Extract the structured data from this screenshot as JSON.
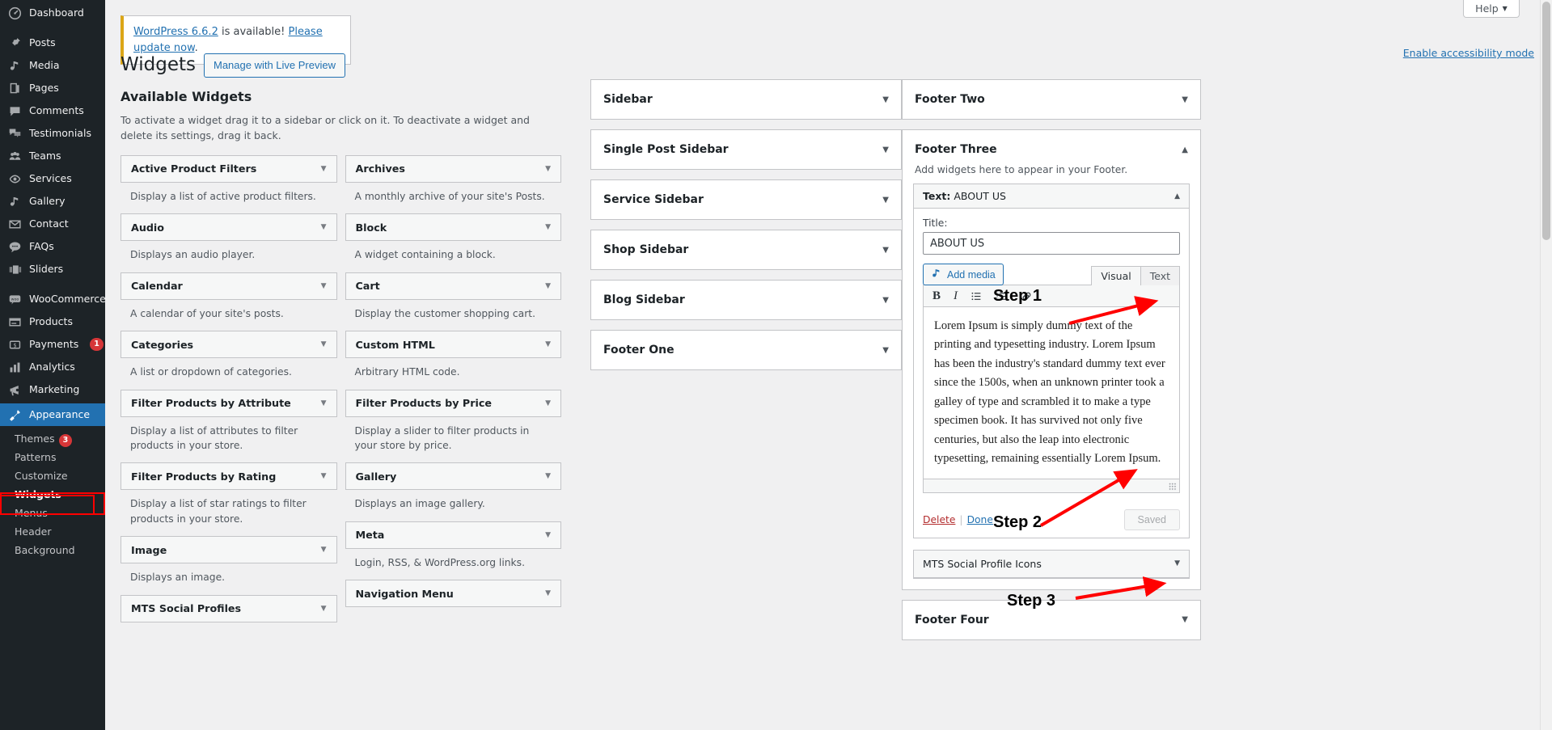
{
  "admin_menu": {
    "items": [
      {
        "label": "Dashboard",
        "icon": "dashboard-icon",
        "badge": null
      },
      {
        "label": "Posts",
        "icon": "pin-icon",
        "badge": null,
        "gap": true
      },
      {
        "label": "Media",
        "icon": "media-icon",
        "badge": null
      },
      {
        "label": "Pages",
        "icon": "pages-icon",
        "badge": null
      },
      {
        "label": "Comments",
        "icon": "comments-icon",
        "badge": null
      },
      {
        "label": "Testimonials",
        "icon": "testimonials-icon",
        "badge": null
      },
      {
        "label": "Teams",
        "icon": "teams-icon",
        "badge": null
      },
      {
        "label": "Services",
        "icon": "services-icon",
        "badge": null
      },
      {
        "label": "Gallery",
        "icon": "gallery-icon",
        "badge": null
      },
      {
        "label": "Contact",
        "icon": "contact-icon",
        "badge": null
      },
      {
        "label": "FAQs",
        "icon": "faqs-icon",
        "badge": null
      },
      {
        "label": "Sliders",
        "icon": "sliders-icon",
        "badge": null
      },
      {
        "label": "WooCommerce",
        "icon": "woocommerce-icon",
        "badge": null,
        "gap": true
      },
      {
        "label": "Products",
        "icon": "products-icon",
        "badge": null
      },
      {
        "label": "Payments",
        "icon": "payments-icon",
        "badge": "1"
      },
      {
        "label": "Analytics",
        "icon": "analytics-icon",
        "badge": null
      },
      {
        "label": "Marketing",
        "icon": "marketing-icon",
        "badge": null
      },
      {
        "label": "Appearance",
        "icon": "appearance-icon",
        "badge": null,
        "current": true
      }
    ],
    "submenu": [
      {
        "label": "Themes",
        "badge": "3"
      },
      {
        "label": "Patterns",
        "badge": null
      },
      {
        "label": "Customize",
        "badge": null
      },
      {
        "label": "Widgets",
        "badge": null,
        "active": true
      },
      {
        "label": "Menus",
        "badge": null
      },
      {
        "label": "Header",
        "badge": null
      },
      {
        "label": "Background",
        "badge": null
      }
    ]
  },
  "notice": {
    "link_version": "WordPress 6.6.2",
    "middle": " is available! ",
    "link_update": "Please update now",
    "period": "."
  },
  "header": {
    "help_label": "Help",
    "accessibility_link": "Enable accessibility mode",
    "page_title": "Widgets",
    "live_preview_label": "Manage with Live Preview"
  },
  "available": {
    "title": "Available Widgets",
    "description": "To activate a widget drag it to a sidebar or click on it. To deactivate a widget and delete its settings, drag it back.",
    "widgets_left": [
      {
        "name": "Active Product Filters",
        "desc": "Display a list of active product filters."
      },
      {
        "name": "Audio",
        "desc": "Displays an audio player."
      },
      {
        "name": "Calendar",
        "desc": "A calendar of your site's posts."
      },
      {
        "name": "Categories",
        "desc": "A list or dropdown of categories."
      },
      {
        "name": "Filter Products by Attribute",
        "desc": "Display a list of attributes to filter products in your store."
      },
      {
        "name": "Filter Products by Rating",
        "desc": "Display a list of star ratings to filter products in your store."
      },
      {
        "name": "Image",
        "desc": "Displays an image."
      },
      {
        "name": "MTS Social Profiles",
        "desc": ""
      }
    ],
    "widgets_right": [
      {
        "name": "Archives",
        "desc": "A monthly archive of your site's Posts."
      },
      {
        "name": "Block",
        "desc": "A widget containing a block."
      },
      {
        "name": "Cart",
        "desc": "Display the customer shopping cart."
      },
      {
        "name": "Custom HTML",
        "desc": "Arbitrary HTML code."
      },
      {
        "name": "Filter Products by Price",
        "desc": "Display a slider to filter products in your store by price."
      },
      {
        "name": "Gallery",
        "desc": "Displays an image gallery."
      },
      {
        "name": "Meta",
        "desc": "Login, RSS, & WordPress.org links."
      },
      {
        "name": "Navigation Menu",
        "desc": ""
      }
    ]
  },
  "sidebars": [
    {
      "name": "Sidebar"
    },
    {
      "name": "Single Post Sidebar"
    },
    {
      "name": "Service Sidebar"
    },
    {
      "name": "Shop Sidebar"
    },
    {
      "name": "Blog Sidebar"
    },
    {
      "name": "Footer One"
    }
  ],
  "footers": {
    "footer_two": {
      "name": "Footer Two"
    },
    "footer_three": {
      "name": "Footer Three",
      "description": "Add widgets here to appear in your Footer.",
      "widget": {
        "header": "Text: ABOUT US",
        "header_prefix": "Text:",
        "header_value": "ABOUT US",
        "title_label": "Title:",
        "title_value": "ABOUT US",
        "add_media_label": "Add media",
        "tab_visual": "Visual",
        "tab_text": "Text",
        "content": "Lorem Ipsum is simply dummy text of the printing and typesetting industry. Lorem Ipsum has been the industry's standard dummy text ever since the 1500s, when an unknown printer took a galley of type and scrambled it to make a type specimen book. It has survived not only five centuries, but also the leap into electronic typesetting, remaining essentially Lorem Ipsum.",
        "delete_label": "Delete",
        "separator": "|",
        "done_label": "Done",
        "saved_label": "Saved",
        "toolbar": [
          "bold-icon",
          "italic-icon",
          "bulleted-list-icon",
          "numbered-list-icon",
          "link-icon"
        ]
      },
      "collapsed_widget": {
        "name": "MTS Social Profile Icons"
      }
    },
    "footer_four": {
      "name": "Footer Four"
    }
  },
  "annotations": {
    "step1": "Step 1",
    "step2": "Step 2",
    "step3": "Step 3",
    "arrow_color": "#ff0000",
    "highlight_color": "#ff0000"
  }
}
